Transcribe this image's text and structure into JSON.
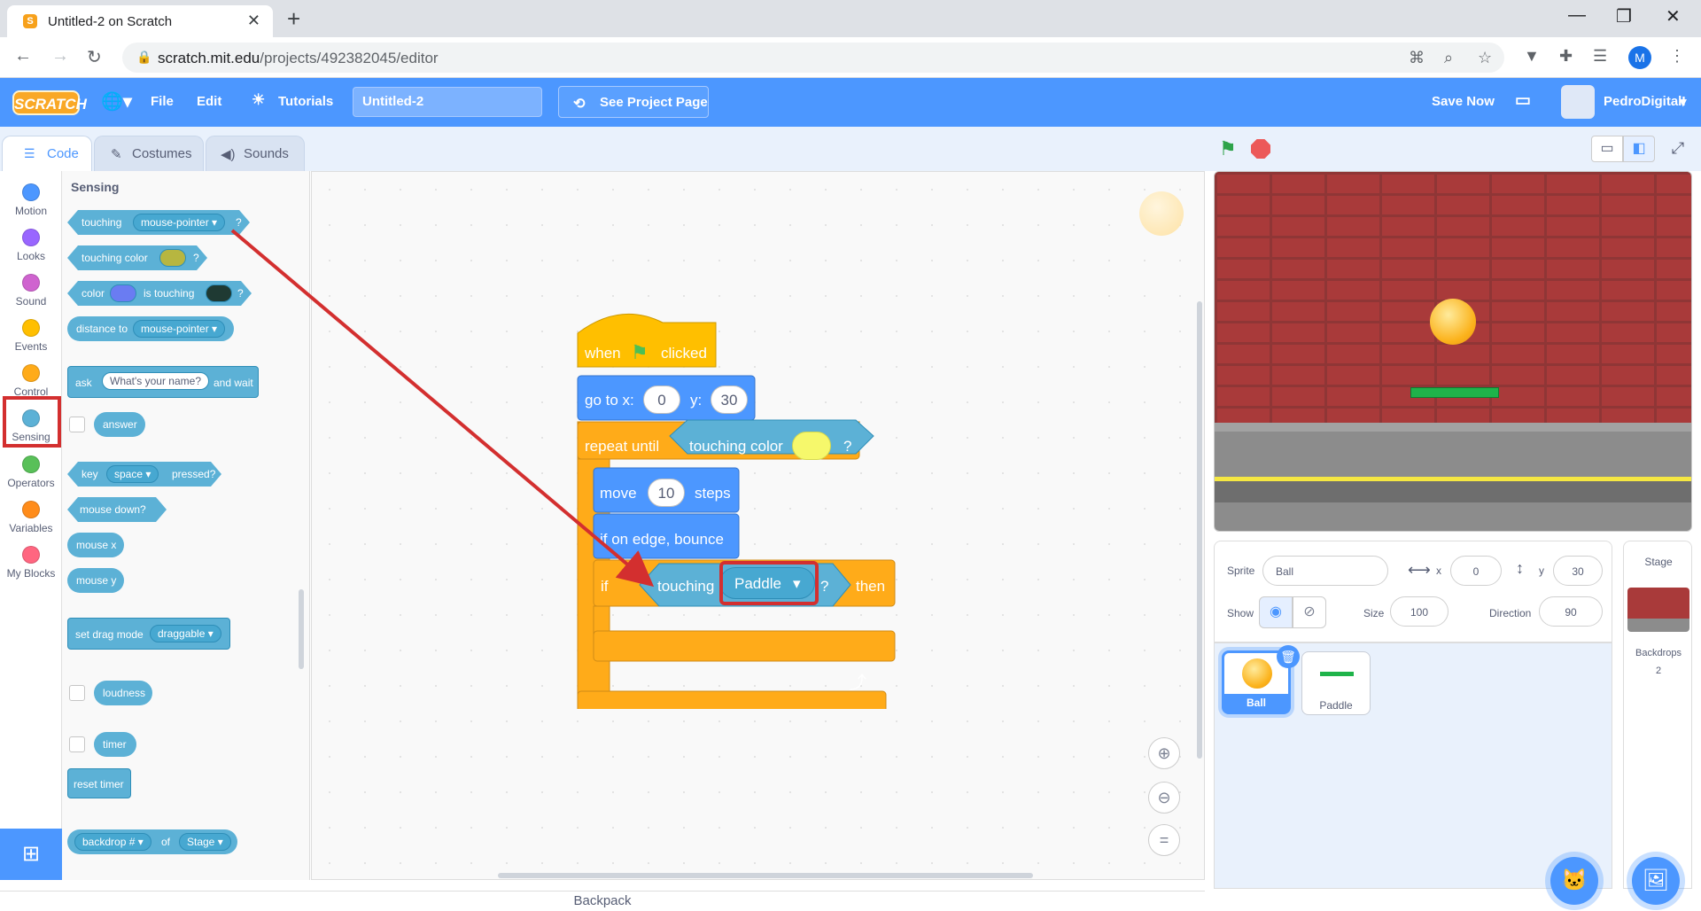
{
  "browser": {
    "tab_title": "Untitled-2 on Scratch",
    "favicon": "S",
    "url_host": "scratch.mit.edu",
    "url_path": "/projects/492382045/editor",
    "profile_initial": "M"
  },
  "menubar": {
    "logo": "SCRATCH",
    "file": "File",
    "edit": "Edit",
    "tutorials": "Tutorials",
    "project_title": "Untitled-2",
    "see_project": "See Project Page",
    "save_now": "Save Now",
    "username": "PedroDigitalI"
  },
  "tabs": {
    "code": "Code",
    "costumes": "Costumes",
    "sounds": "Sounds"
  },
  "categories": [
    {
      "label": "Motion",
      "color": "#4c97ff"
    },
    {
      "label": "Looks",
      "color": "#9966ff"
    },
    {
      "label": "Sound",
      "color": "#cf63cf"
    },
    {
      "label": "Events",
      "color": "#ffbf00"
    },
    {
      "label": "Control",
      "color": "#ffab19"
    },
    {
      "label": "Sensing",
      "color": "#5cb1d6"
    },
    {
      "label": "Operators",
      "color": "#59c059"
    },
    {
      "label": "Variables",
      "color": "#ff8c1a"
    },
    {
      "label": "My Blocks",
      "color": "#ff6680"
    }
  ],
  "palette": {
    "title": "Sensing",
    "touching": "touching",
    "touching_menu": "mouse-pointer",
    "q": "?",
    "touching_color": "touching color",
    "color": "color",
    "is_touching": "is touching",
    "distance_to": "distance to",
    "distance_menu": "mouse-pointer",
    "ask": "ask",
    "ask_default": "What's your name?",
    "and_wait": "and wait",
    "answer": "answer",
    "key": "key",
    "key_menu": "space",
    "pressed": "pressed?",
    "mouse_down": "mouse down?",
    "mouse_x": "mouse x",
    "mouse_y": "mouse y",
    "set_drag_mode": "set drag mode",
    "drag_menu": "draggable",
    "loudness": "loudness",
    "timer": "timer",
    "reset_timer": "reset timer",
    "backdrop": "backdrop #",
    "of": "of",
    "stage_menu": "Stage"
  },
  "script": {
    "when": "when",
    "clicked": "clicked",
    "goto": "go to x:",
    "x": "0",
    "y_lbl": "y:",
    "y": "30",
    "repeat_until": "repeat until",
    "touching_color": "touching color",
    "q": "?",
    "move": "move",
    "steps_val": "10",
    "steps": "steps",
    "bounce": "if on edge, bounce",
    "if": "if",
    "touching": "touching",
    "paddle": "Paddle",
    "then": "then"
  },
  "sprite_info": {
    "sprite_lbl": "Sprite",
    "sprite_name": "Ball",
    "x_lbl": "x",
    "x": "0",
    "y_lbl": "y",
    "y": "30",
    "show_lbl": "Show",
    "size_lbl": "Size",
    "size": "100",
    "direction_lbl": "Direction",
    "direction": "90"
  },
  "sprites": [
    {
      "name": "Ball"
    },
    {
      "name": "Paddle"
    }
  ],
  "stage_panel": {
    "title": "Stage",
    "backdrops_lbl": "Backdrops",
    "backdrops_count": "2"
  },
  "backpack": "Backpack",
  "colors": {
    "motion": "#4c97ff",
    "control": "#ffab19",
    "events": "#ffbf00",
    "sensing": "#5cb1d6",
    "highlight": "#d32f2f"
  }
}
